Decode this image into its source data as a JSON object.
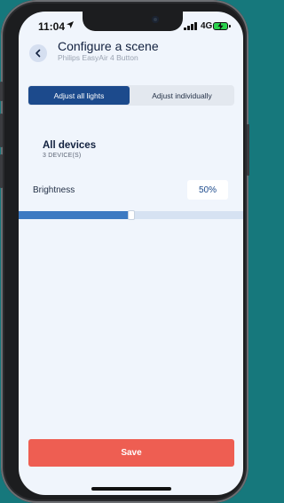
{
  "status_bar": {
    "time": "11:04",
    "network": "4G",
    "icons": [
      "location-arrow-icon",
      "signal-bars-icon",
      "battery-charging-icon"
    ]
  },
  "header": {
    "title": "Configure a scene",
    "subtitle": "Philips EasyAir 4 Button",
    "back_icon": "chevron-left-icon"
  },
  "segmented_control": {
    "options": [
      "Adjust all lights",
      "Adjust individually"
    ],
    "selected_index": 0
  },
  "group": {
    "name": "All devices",
    "device_count": "3 DEVICE(S)"
  },
  "brightness": {
    "label": "Brightness",
    "value_text": "50%",
    "level": 0.5
  },
  "save_label": "Save",
  "colors": {
    "background": "#f0f5fc",
    "accent": "#1c4a8c",
    "slider_fill": "#3d7ac2",
    "save": "#ee5e52"
  }
}
